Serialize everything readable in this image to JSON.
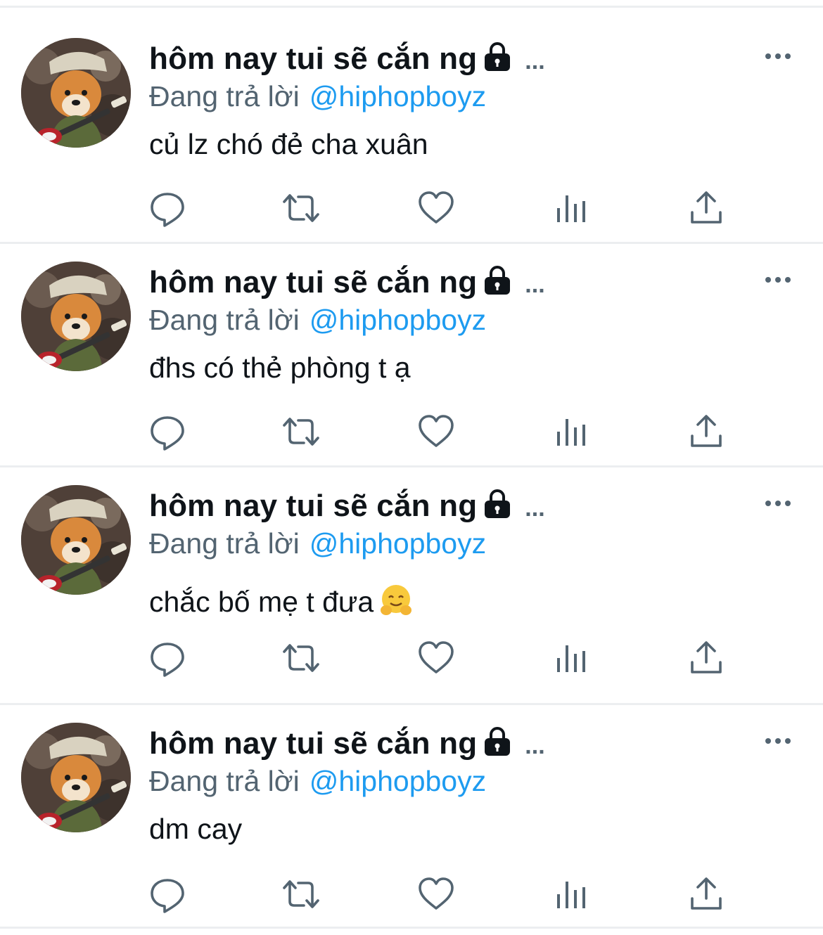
{
  "tweets": [
    {
      "display_name": "hôm nay tui sẽ cắn ng",
      "ellipsis": "...",
      "reply_prefix": "Đang trả lời",
      "reply_handle": "@hiphopboyz",
      "text": "củ lz chó đẻ cha xuân",
      "emoji": null
    },
    {
      "display_name": "hôm nay tui sẽ cắn ng",
      "ellipsis": "...",
      "reply_prefix": "Đang trả lời",
      "reply_handle": "@hiphopboyz",
      "text": "đhs có thẻ phòng t ạ",
      "emoji": null
    },
    {
      "display_name": "hôm nay tui sẽ cắn ng",
      "ellipsis": "...",
      "reply_prefix": "Đang trả lời",
      "reply_handle": "@hiphopboyz",
      "text": "chắc bố mẹ t đưa",
      "emoji": "hugging-face-emoji"
    },
    {
      "display_name": "hôm nay tui sẽ cắn ng",
      "ellipsis": "...",
      "reply_prefix": "Đang trả lời",
      "reply_handle": "@hiphopboyz",
      "text": "dm cay",
      "emoji": null
    }
  ],
  "icons": {
    "lock": "lock-icon",
    "more": "more-horizontal-icon",
    "reply": "reply-icon",
    "retweet": "retweet-icon",
    "like": "heart-icon",
    "views": "views-chart-icon",
    "share": "share-icon"
  },
  "colors": {
    "text": "#0f1419",
    "secondary": "#536471",
    "link": "#1d9bf0",
    "divider": "#eceef0"
  }
}
